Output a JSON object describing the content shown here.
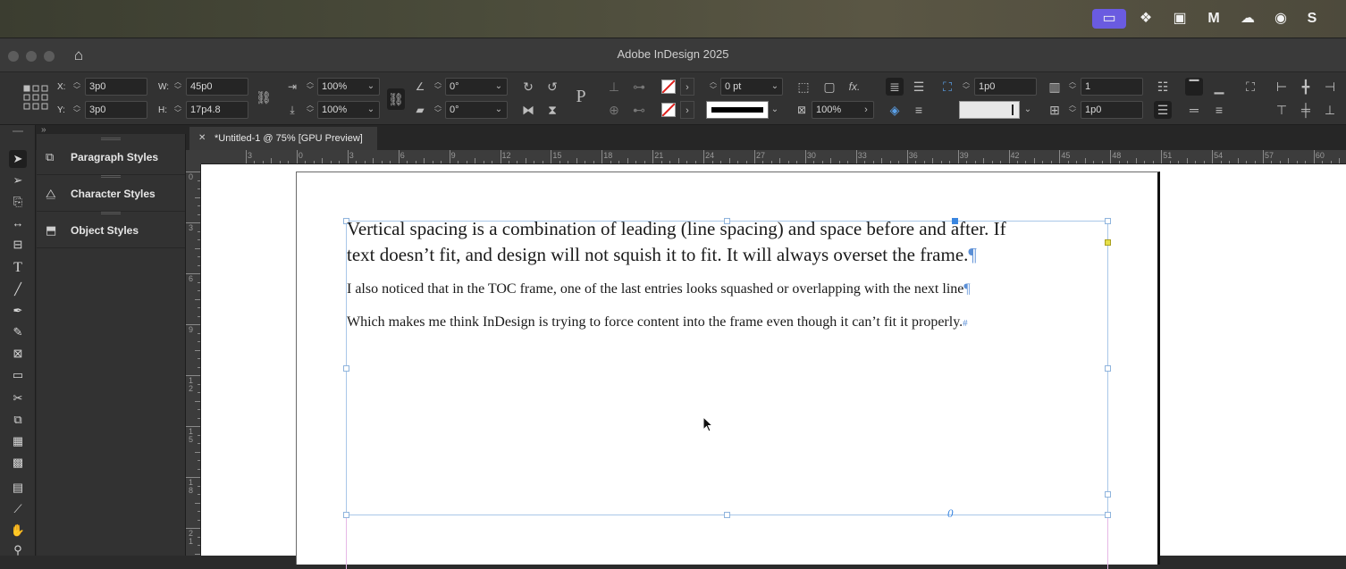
{
  "app": {
    "window_title": "Adobe InDesign 2025",
    "doc_tab_label": "*Untitled-1 @ 75% [GPU Preview]",
    "close_glyph": "✕"
  },
  "control_panel": {
    "x_label": "X:",
    "x_value": "3p0",
    "y_label": "Y:",
    "y_value": "3p0",
    "w_label": "W:",
    "w_value": "45p0",
    "h_label": "H:",
    "h_value": "17p4.8",
    "scale_x_value": "100%",
    "scale_y_value": "100%",
    "rotate_value": "0°",
    "shear_value": "0°",
    "stroke_weight_value": "0 pt",
    "opacity_value": "100%",
    "gutter_value": "1p0",
    "columns_value": "1",
    "inset_value": "1p0",
    "fx_label": "fx."
  },
  "panels": {
    "items": [
      {
        "label": "Paragraph Styles",
        "icon": "paragraph-styles-icon"
      },
      {
        "label": "Character Styles",
        "icon": "character-styles-icon"
      },
      {
        "label": "Object Styles",
        "icon": "object-styles-icon"
      }
    ]
  },
  "rulers": {
    "horizontal": [
      "3",
      "0",
      "3",
      "6",
      "9",
      "12",
      "15",
      "18",
      "21",
      "24",
      "27",
      "30",
      "33",
      "36",
      "39",
      "42",
      "45",
      "48",
      "51",
      "54",
      "57",
      "60"
    ],
    "vertical": [
      "0",
      "3",
      "6",
      "9",
      "1\n2",
      "1\n5",
      "1\n8",
      "2\n1"
    ]
  },
  "document": {
    "para1_line1": "Vertical spacing is a combination of leading (line spacing) and space before and after. If",
    "para1_line2": "text doesn’t fit, and design will not squish it to fit. It will always overset the frame.",
    "para2": "I also noticed that in the TOC frame, one of the last entries looks squashed or overlapping with the next line",
    "para3": "Which makes me think InDesign is trying to force content into the frame even though it can’t fit it properly.",
    "pilcrow": "¶",
    "end_mark": "#",
    "anchor_mark": "0"
  }
}
